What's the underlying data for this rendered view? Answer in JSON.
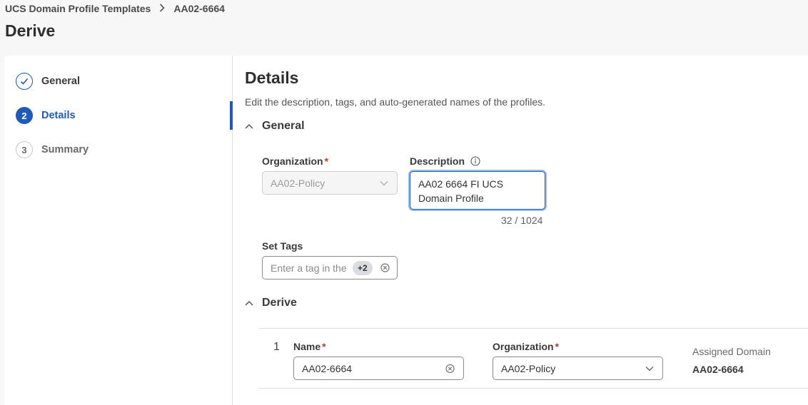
{
  "breadcrumb": {
    "parent": "UCS Domain Profile Templates",
    "current": "AA02-6664"
  },
  "page_title": "Derive",
  "wizard": {
    "steps": [
      {
        "number": "",
        "label": "General",
        "state": "completed"
      },
      {
        "number": "2",
        "label": "Details",
        "state": "active"
      },
      {
        "number": "3",
        "label": "Summary",
        "state": "pending"
      }
    ]
  },
  "details": {
    "title": "Details",
    "subtitle": "Edit the description, tags, and auto-generated names of the profiles.",
    "general_section": "General",
    "organization_label": "Organization",
    "organization_value": "AA02-Policy",
    "description_label": "Description",
    "description_value": "AA02 6664 FI UCS Domain Profile",
    "description_counter": "32 / 1024",
    "tags_label": "Set Tags",
    "tags_placeholder": "Enter a tag in the",
    "tags_more": "+2",
    "derive_section": "Derive",
    "derive_rows": [
      {
        "index": "1",
        "name_label": "Name",
        "name_value": "AA02-6664",
        "org_label": "Organization",
        "org_value": "AA02-Policy",
        "assigned_label": "Assigned Domain",
        "assigned_value": "AA02-6664"
      }
    ]
  },
  "colors": {
    "accent": "#1e5bb8",
    "required": "#c0392b"
  }
}
